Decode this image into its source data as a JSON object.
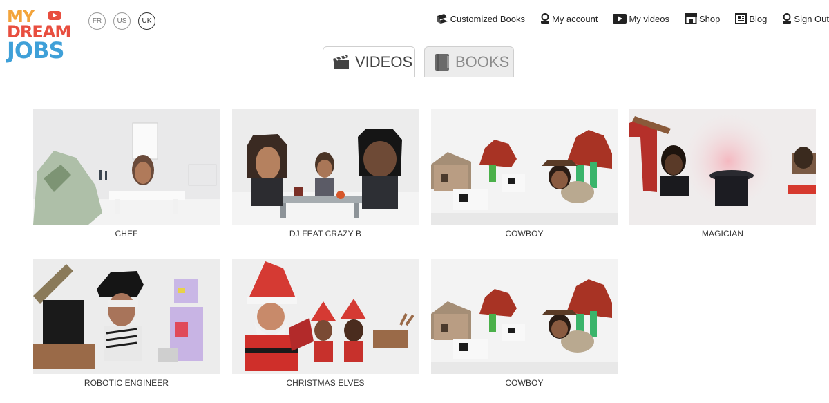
{
  "logo": {
    "line1": "MY",
    "line2": "DREAM",
    "line3": "JOBS"
  },
  "languages": [
    {
      "code": "FR",
      "active": false
    },
    {
      "code": "US",
      "active": false
    },
    {
      "code": "UK",
      "active": true
    }
  ],
  "nav": {
    "customized_books": "Customized Books",
    "my_account": "My account",
    "my_videos": "My videos",
    "shop": "Shop",
    "blog": "Blog",
    "sign_out": "Sign Out"
  },
  "tabs": {
    "videos": "VIDEOS",
    "books": "BOOKS",
    "active": "videos"
  },
  "videos": [
    {
      "title": "CHEF"
    },
    {
      "title": "DJ FEAT CRAZY B"
    },
    {
      "title": "COWBOY"
    },
    {
      "title": "MAGICIAN"
    },
    {
      "title": "ROBOTIC ENGINEER"
    },
    {
      "title": "CHRISTMAS ELVES"
    },
    {
      "title": "COWBOY"
    }
  ],
  "colors": {
    "logo_orange": "#f3a43b",
    "logo_red": "#e84e3f",
    "logo_blue": "#3fa0d8",
    "logo_green": "#7cc04b"
  }
}
